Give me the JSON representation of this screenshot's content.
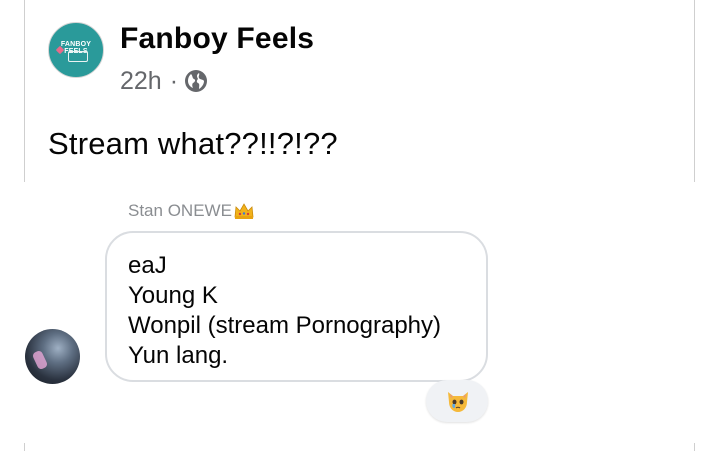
{
  "post": {
    "page_name": "Fanboy Feels",
    "avatar_logo_text": "FANBOY FEELS",
    "time": "22h",
    "separator": "·",
    "audience_icon": "globe-icon",
    "text": "Stream what??!!?!??"
  },
  "comment": {
    "author": "Stan ONEWE",
    "author_badge_icon": "crown-icon",
    "lines": [
      "eaJ",
      "Young K",
      "Wonpil (stream Pornography)",
      "Yun lang."
    ],
    "reaction_icon": "crying-cat-face-icon"
  },
  "colors": {
    "text": "#050505",
    "secondary_text": "#65676b",
    "avatar_teal": "#2a9a9a",
    "bubble_border": "#dadde1"
  }
}
